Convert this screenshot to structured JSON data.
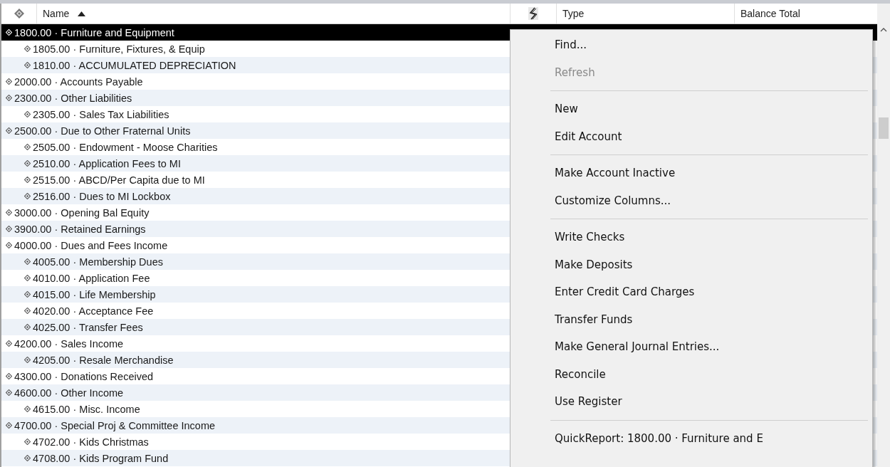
{
  "table": {
    "columns": [
      {
        "label": "Name",
        "sorted": true
      },
      {
        "label": "Type"
      },
      {
        "label": "Balance Total"
      }
    ],
    "rows": [
      {
        "name": "1800.00 · Furniture and Equipment",
        "selected": true,
        "children": [
          {
            "name": "1805.00 · Furniture, Fixtures, & Equip",
            "selected": false
          },
          {
            "name": "1810.00 · ACCUMULATED DEPRECIATION",
            "selected": false
          }
        ]
      },
      {
        "name": "2000.00 · Accounts Payable",
        "selected": false
      },
      {
        "name": "2300.00 · Other Liabilities",
        "selected": false,
        "children": [
          {
            "name": "2305.00 · Sales Tax Liabilities",
            "selected": false
          }
        ]
      },
      {
        "name": "2500.00 · Due to Other Fraternal Units",
        "selected": false,
        "children": [
          {
            "name": "2505.00 · Endowment - Moose Charities",
            "selected": false
          },
          {
            "name": "2510.00 · Application Fees to MI",
            "selected": false
          },
          {
            "name": "2515.00 · ABCD/Per Capita due to MI",
            "selected": false
          },
          {
            "name": "2516.00 · Dues to MI Lockbox",
            "selected": false
          }
        ]
      },
      {
        "name": "3000.00 · Opening Bal Equity",
        "selected": false
      },
      {
        "name": "3900.00 · Retained Earnings",
        "selected": false
      },
      {
        "name": "4000.00 · Dues and Fees Income",
        "selected": false,
        "children": [
          {
            "name": "4005.00 · Membership Dues",
            "selected": false
          },
          {
            "name": "4010.00 · Application Fee",
            "selected": false
          },
          {
            "name": "4015.00 · Life Membership",
            "selected": false
          },
          {
            "name": "4020.00 · Acceptance Fee",
            "selected": false
          },
          {
            "name": "4025.00 · Transfer Fees",
            "selected": false
          }
        ]
      },
      {
        "name": "4200.00 · Sales Income",
        "selected": false,
        "children": [
          {
            "name": "4205.00 · Resale Merchandise",
            "selected": false
          }
        ]
      },
      {
        "name": "4300.00 · Donations Received",
        "selected": false
      },
      {
        "name": "4600.00 · Other Income",
        "selected": false,
        "children": [
          {
            "name": "4615.00 · Misc. Income",
            "selected": false
          }
        ]
      },
      {
        "name": "4700.00 · Special Proj & Committee Income",
        "selected": false,
        "children": [
          {
            "name": "4702.00 · Kids Christmas",
            "selected": false
          },
          {
            "name": "4708.00 · Kids Program Fund",
            "selected": false
          }
        ]
      }
    ]
  },
  "context_menu": {
    "groups": [
      [
        {
          "label": "Find...",
          "disabled": false
        },
        {
          "label": "Refresh",
          "disabled": true
        }
      ],
      [
        {
          "label": "New",
          "disabled": false
        },
        {
          "label": "Edit Account",
          "disabled": false
        }
      ],
      [
        {
          "label": "Make Account Inactive",
          "disabled": false
        },
        {
          "label": "Customize Columns...",
          "disabled": false
        }
      ],
      [
        {
          "label": "Write Checks",
          "disabled": false
        },
        {
          "label": "Make Deposits",
          "disabled": false
        },
        {
          "label": "Enter Credit Card Charges",
          "disabled": false
        },
        {
          "label": "Transfer Funds",
          "disabled": false
        },
        {
          "label": "Make General Journal Entries...",
          "disabled": false
        },
        {
          "label": "Reconcile",
          "disabled": false
        },
        {
          "label": "Use Register",
          "disabled": false
        }
      ],
      [
        {
          "label": "QuickReport: 1800.00 · Furniture and E",
          "disabled": false
        }
      ]
    ]
  }
}
